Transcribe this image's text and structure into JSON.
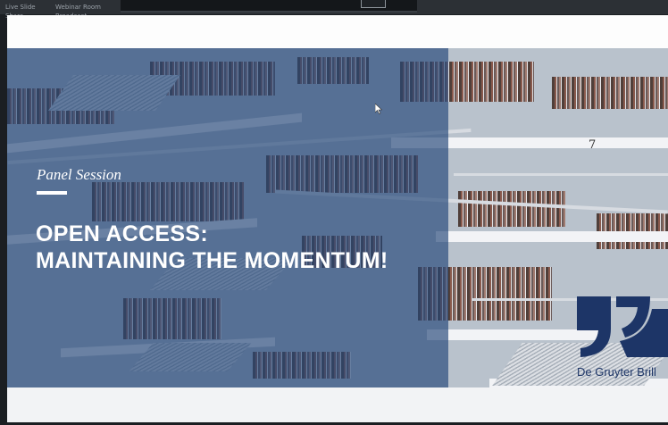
{
  "window": {
    "tab1": "Live Slide Share",
    "tab2": "Webinar Room Broadcast"
  },
  "slide": {
    "session_label": "Panel Session",
    "title_line1": "OPEN ACCESS:",
    "title_line2": "MAINTAINING THE MOMENTUM!",
    "brand": "De Gruyter Brill",
    "sign": "7"
  },
  "colors": {
    "overlay": "#234678",
    "brand": "#1d3567"
  }
}
